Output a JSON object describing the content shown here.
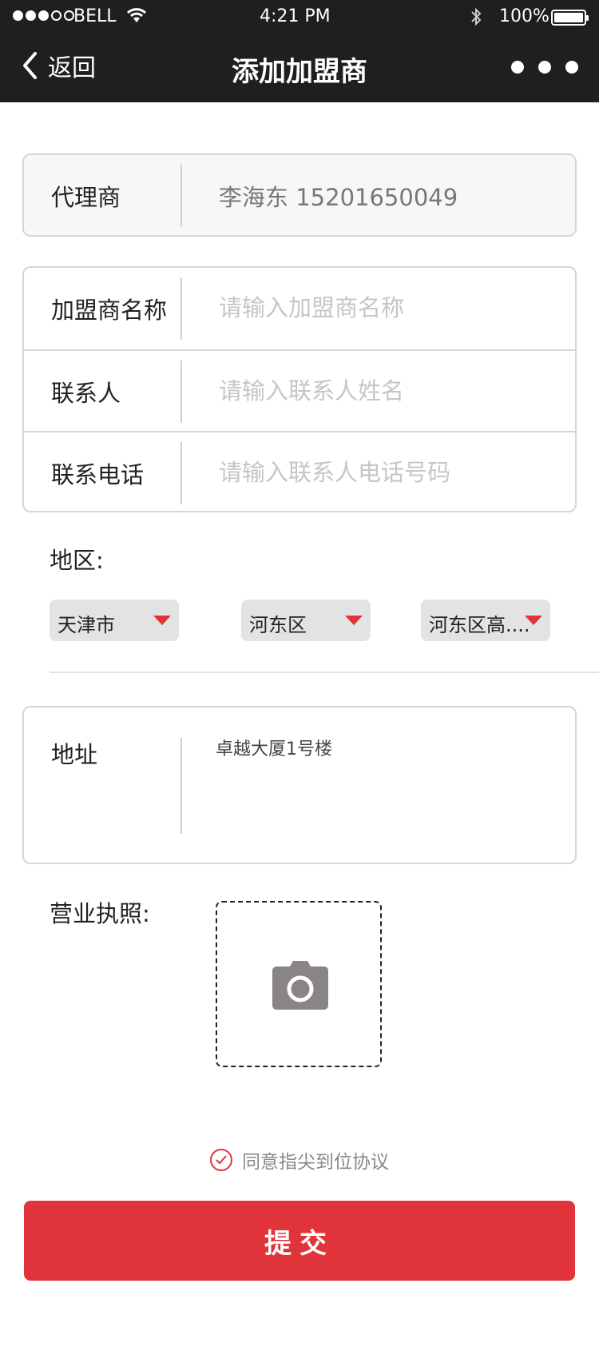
{
  "status_bar": {
    "carrier": "BELL",
    "time": "4:21 PM",
    "battery": "100%"
  },
  "nav": {
    "back_label": "返回",
    "title": "添加加盟商"
  },
  "agent": {
    "label": "代理商",
    "value": "李海东 15201650049"
  },
  "form": {
    "franchise_name": {
      "label": "加盟商名称",
      "placeholder": "请输入加盟商名称"
    },
    "contact": {
      "label": "联系人",
      "placeholder": "请输入联系人姓名"
    },
    "phone": {
      "label": "联系电话",
      "placeholder": "请输入联系人电话号码"
    }
  },
  "region": {
    "label": "地区:",
    "city": "天津市",
    "district": "河东区",
    "area": "河东区高...."
  },
  "address": {
    "label": "地址",
    "value": "卓越大厦1号楼"
  },
  "license": {
    "label": "营业执照:"
  },
  "agreement": {
    "text": "同意指尖到位协议"
  },
  "submit_label": "提交",
  "colors": {
    "accent": "#e0343a",
    "topbar": "#1f1f1f"
  }
}
